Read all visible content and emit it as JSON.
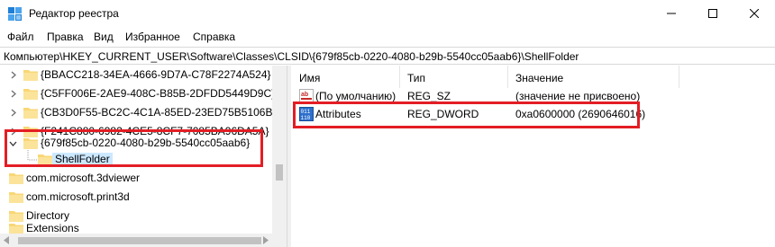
{
  "window": {
    "title": "Редактор реестра",
    "minimize_icon": "minimize-icon",
    "maximize_icon": "maximize-icon",
    "close_icon": "close-icon"
  },
  "menu": [
    "Файл",
    "Правка",
    "Вид",
    "Избранное",
    "Справка"
  ],
  "address": "Компьютер\\HKEY_CURRENT_USER\\Software\\Classes\\CLSID\\{679f85cb-0220-4080-b29b-5540cc05aab6}\\ShellFolder",
  "tree": [
    {
      "label": "{BBACC218-34EA-4666-9D7A-C78F2274A524}",
      "expander": "collapsed"
    },
    {
      "label": "{C5FF006E-2AE9-408C-B85B-2DFDD5449D9C}",
      "expander": "collapsed"
    },
    {
      "label": "{CB3D0F55-BC2C-4C1A-85ED-23ED75B5106B}",
      "expander": "collapsed"
    },
    {
      "label": "{F241C880-6982-4CE5-8CF7-7085BA96DA5A}",
      "expander": "collapsed"
    },
    {
      "label": "{679f85cb-0220-4080-b29b-5540cc05aab6}",
      "expander": "expanded"
    },
    {
      "label": "ShellFolder",
      "expander": "none",
      "selected": true
    },
    {
      "label": "com.microsoft.3dviewer",
      "expander": "none"
    },
    {
      "label": "com.microsoft.print3d",
      "expander": "none"
    },
    {
      "label": "Directory",
      "expander": "none"
    },
    {
      "label": "Extensions",
      "expander": "none"
    }
  ],
  "columns": [
    "Имя",
    "Тип",
    "Значение"
  ],
  "values": [
    {
      "name": "(По умолчанию)",
      "type": "REG_SZ",
      "data": "(значение не присвоено)",
      "icon": "string-value-icon"
    },
    {
      "name": "Attributes",
      "type": "REG_DWORD",
      "data": "0xa0600000 (2690646016)",
      "icon": "binary-value-icon"
    }
  ],
  "colors": {
    "highlight": "#e31d24",
    "selection": "#cce8ff",
    "folder": "#f8d775"
  }
}
